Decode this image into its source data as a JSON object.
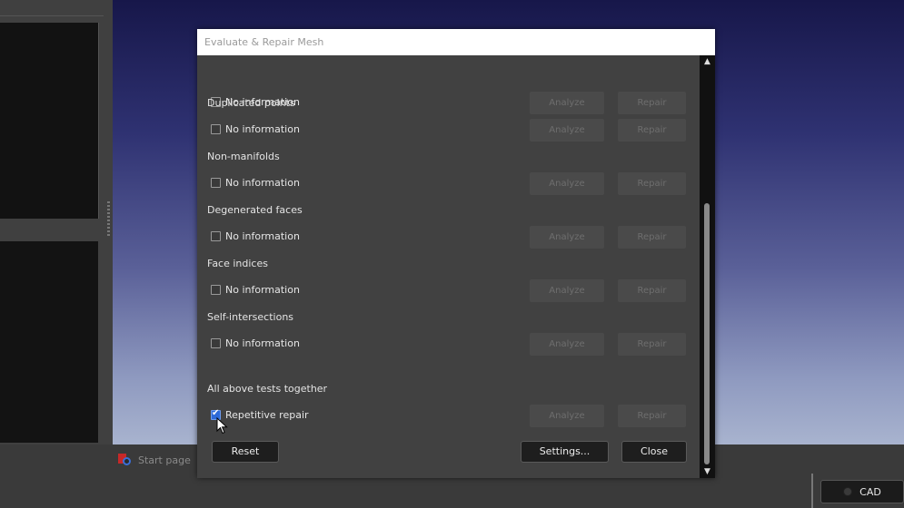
{
  "dialog": {
    "title": "Evaluate & Repair Mesh",
    "rows": [
      {
        "section": "",
        "check_label": "No information",
        "checked": false,
        "analyze": "Analyze",
        "repair": "Repair"
      },
      {
        "section": "Duplicated points",
        "check_label": "No information",
        "checked": false,
        "analyze": "Analyze",
        "repair": "Repair"
      },
      {
        "section": "Non-manifolds",
        "check_label": "No information",
        "checked": false,
        "analyze": "Analyze",
        "repair": "Repair"
      },
      {
        "section": "Degenerated faces",
        "check_label": "No information",
        "checked": false,
        "analyze": "Analyze",
        "repair": "Repair"
      },
      {
        "section": "Face indices",
        "check_label": "No information",
        "checked": false,
        "analyze": "Analyze",
        "repair": "Repair"
      },
      {
        "section": "Self-intersections",
        "check_label": "No information",
        "checked": false,
        "analyze": "Analyze",
        "repair": "Repair"
      },
      {
        "section": "All above tests together",
        "check_label": "Repetitive repair",
        "checked": true,
        "analyze": "Analyze",
        "repair": "Repair"
      }
    ],
    "reset_label": "Reset",
    "settings_label": "Settings...",
    "close_label": "Close"
  },
  "tabs": {
    "start_page": "Start page"
  },
  "workbench": {
    "label": "CAD"
  },
  "colors": {
    "checkbox_checked": "#2d6ad8",
    "dialog_bg": "#414141",
    "titlebar_bg": "#ffffff"
  }
}
